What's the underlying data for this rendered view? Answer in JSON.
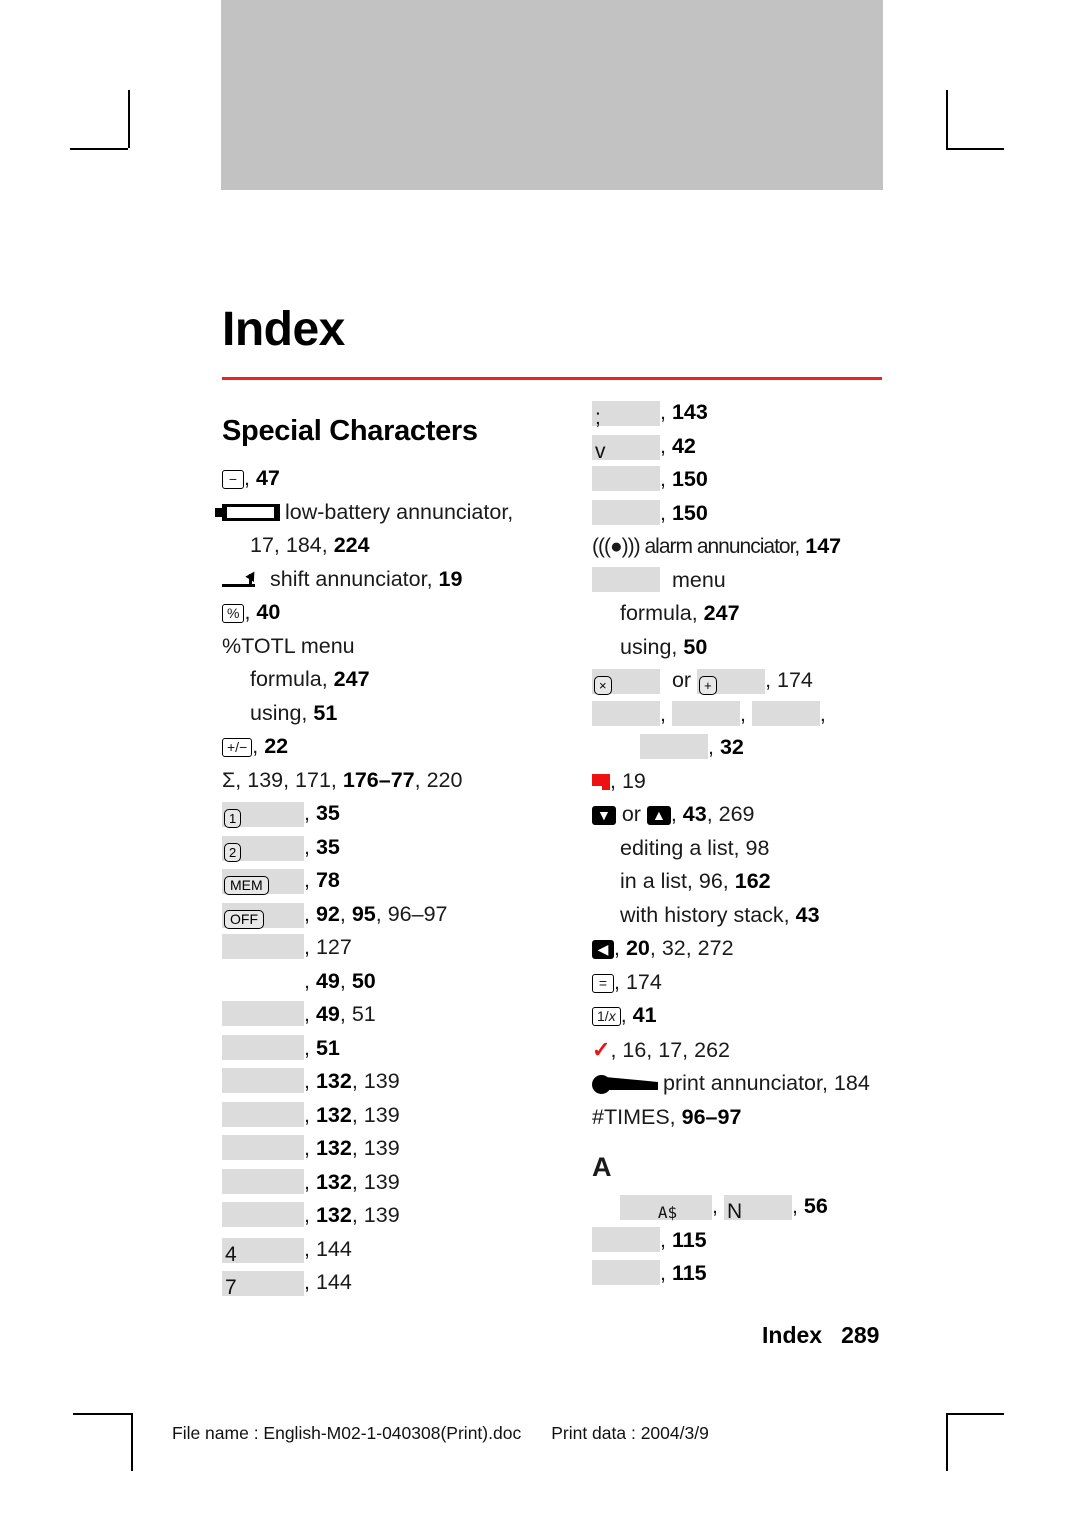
{
  "page": {
    "title": "Index",
    "section_heading": "Special Characters",
    "letter_heading_a": "A",
    "folio_label": "Index",
    "folio_number": "289",
    "rule_color": "#ee2222",
    "banner_color": "#c2c2c2",
    "placeholder_color": "#dcdcdc"
  },
  "footer": {
    "file_name_label": "File name : English-M02-1-040308(Print).doc",
    "print_data_label": "Print data : 2004/3/9"
  },
  "left_column": [
    {
      "icon": "minus-key-icon",
      "label": "",
      "pages": ", 47"
    },
    {
      "icon": "battery-annunciator-icon",
      "label": "low-battery annunciator,",
      "pages": ""
    },
    {
      "icon": "",
      "label": "",
      "pages": "17, 184, 224",
      "indent": 1
    },
    {
      "icon": "shift-annunciator-icon",
      "label": "shift annunciator,",
      "pages": " 19"
    },
    {
      "icon": "percent-key-icon",
      "label": "",
      "pages": ", 40"
    },
    {
      "icon": "",
      "label": "%TOTL menu",
      "pages": ""
    },
    {
      "icon": "",
      "label": "formula,",
      "pages": " 247",
      "indent": 1
    },
    {
      "icon": "",
      "label": "using,",
      "pages": " 51",
      "indent": 1
    },
    {
      "icon": "plus-minus-key-icon",
      "label": "",
      "pages": ", 22"
    },
    {
      "icon": "sigma-icon",
      "label": "Σ,",
      "pages": " 139, 171, 176–77, 220"
    },
    {
      "icon": "missing-glyph-box",
      "boxlabel": "1",
      "pages": ", 35"
    },
    {
      "icon": "missing-glyph-box",
      "boxlabel": "2",
      "pages": ", 35"
    },
    {
      "icon": "missing-glyph-box",
      "boxlabel": "MEM",
      "pages": ", 78"
    },
    {
      "icon": "missing-glyph-box",
      "boxlabel": "OFF",
      "pages": ", 92, 95, 96–97"
    },
    {
      "icon": "missing-glyph-box",
      "boxlabel": "",
      "pages": ", 127"
    },
    {
      "icon": "missing-glyph-box-blank",
      "boxlabel": "",
      "pages": ", 49, 50"
    },
    {
      "icon": "missing-glyph-box",
      "boxlabel": "",
      "pages": ", 49, 51"
    },
    {
      "icon": "missing-glyph-box",
      "boxlabel": "",
      "pages": ", 51"
    },
    {
      "icon": "missing-glyph-box",
      "boxlabel": "",
      "pages": ", 132, 139"
    },
    {
      "icon": "missing-glyph-box",
      "boxlabel": "",
      "pages": ", 132, 139"
    },
    {
      "icon": "missing-glyph-box",
      "boxlabel": "",
      "pages": ", 132, 139"
    },
    {
      "icon": "missing-glyph-box",
      "boxlabel": "",
      "pages": ", 132, 139"
    },
    {
      "icon": "missing-glyph-box",
      "boxlabel": "",
      "pages": ", 132, 139"
    },
    {
      "icon": "missing-glyph-box",
      "boxlabel": "4",
      "pages": ", 144"
    },
    {
      "icon": "missing-glyph-box",
      "boxlabel": "7",
      "pages": ", 144"
    }
  ],
  "right_column": [
    {
      "icon": "missing-glyph-box",
      "boxlabel": ";",
      "pages": ", 143"
    },
    {
      "icon": "missing-glyph-box",
      "boxlabel": "v",
      "pages": ", 42"
    },
    {
      "icon": "missing-glyph-box",
      "boxlabel": "",
      "pages": ", 150"
    },
    {
      "icon": "missing-glyph-box",
      "boxlabel": "",
      "pages": ", 150"
    },
    {
      "icon": "alarm-annunciator-icon",
      "label": "(((●))) alarm annunciator,",
      "pages": " 147"
    },
    {
      "icon": "missing-glyph-box",
      "boxlabel": "",
      "label": "menu",
      "pages": ""
    },
    {
      "icon": "",
      "label": "formula,",
      "pages": " 247",
      "indent": 1
    },
    {
      "icon": "",
      "label": "using,",
      "pages": " 50",
      "indent": 1
    },
    {
      "icon": "multiply-key-box",
      "label": "or",
      "pages": ", 174"
    },
    {
      "icon": "three-missing-glyph-boxes",
      "pages": ","
    },
    {
      "icon": "missing-glyph-box-offset",
      "pages": ", 32"
    },
    {
      "icon": "red-flag-icon",
      "pages": ", 19"
    },
    {
      "icon": "down-up-arrow-keys",
      "label": "or",
      "pages": ", 43, 269"
    },
    {
      "icon": "",
      "label": "editing a list,",
      "pages": " 98",
      "indent": 1
    },
    {
      "icon": "",
      "label": "in a list,",
      "pages": " 96, 162",
      "indent": 1
    },
    {
      "icon": "",
      "label": "with history stack,",
      "pages": " 43",
      "indent": 1
    },
    {
      "icon": "backspace-key-icon",
      "pages": ", 20, 32, 272"
    },
    {
      "icon": "equals-key-icon",
      "pages": ", 174"
    },
    {
      "icon": "reciprocal-key-icon",
      "pages": ", 41"
    },
    {
      "icon": "red-check-icon",
      "pages": ", 16, 17, 262"
    },
    {
      "icon": "print-annunciator-icon",
      "label": "print annunciator,",
      "pages": " 184"
    },
    {
      "icon": "",
      "label": "#TIMES,",
      "pages": " 96–97"
    }
  ],
  "right_column_a": [
    {
      "icon": "a-dollar-display-box",
      "boxlabel": "A$",
      "boxlabel2": "N",
      "pages": ", 56"
    },
    {
      "icon": "missing-glyph-box",
      "boxlabel": "",
      "pages": ", 115"
    },
    {
      "icon": "missing-glyph-box",
      "boxlabel": "",
      "pages": ", 115"
    }
  ],
  "page_numbers_bold": {
    "e0": "47",
    "e1": "224",
    "e2": "19",
    "e3": "40",
    "e4": "247",
    "e5": "51",
    "e6": "22",
    "e7": "176–77",
    "e8": "35",
    "e9": "78",
    "e10": "92",
    "e11": "95",
    "e12": "49",
    "e13": "50",
    "e14": "132",
    "e15": "143",
    "e16": "42",
    "e17": "150",
    "e18": "147",
    "e19": "32",
    "e20": "43",
    "e21": "162",
    "e22": "20",
    "e23": "41",
    "e24": "96–97",
    "e25": "56",
    "e26": "115"
  }
}
